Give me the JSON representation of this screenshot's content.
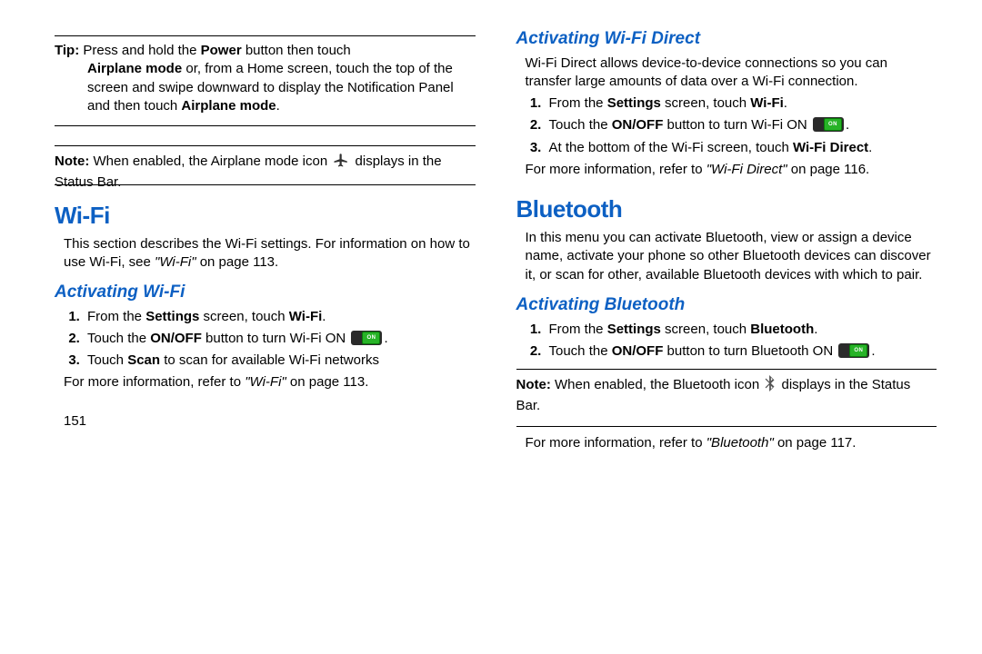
{
  "left": {
    "tip_label": "Tip:",
    "tip_text1": " Press and hold the ",
    "tip_b1": "Power",
    "tip_text2": " button then touch ",
    "tip_line2a": "Airplane mode",
    "tip_line2b": " or, from a Home screen, touch the top of the screen and swipe downward to display the Notification Panel and then touch ",
    "tip_b2": "Airplane mode",
    "tip_end": ".",
    "note_label": "Note:",
    "note_text1": " When enabled, the Airplane mode icon ",
    "note_text2": " displays in the Status Bar.",
    "wifi_h": "Wi-Fi",
    "wifi_p1": "This section describes the Wi-Fi settings. For information on how to use Wi-Fi, see ",
    "wifi_p1_ref": "\"Wi-Fi\"",
    "wifi_p1_end": " on page 113.",
    "act_wifi_h": "Activating Wi-Fi",
    "s1a": "From the ",
    "s1b": "Settings",
    "s1c": " screen, touch ",
    "s1d": "Wi-Fi",
    "s1e": ".",
    "s2a": "Touch the ",
    "s2b": "ON/OFF",
    "s2c": " button to turn Wi-Fi ON ",
    "s2d": ".",
    "s3a": "Touch ",
    "s3b": "Scan",
    "s3c": " to scan for available Wi-Fi networks",
    "more1a": "For more information, refer to ",
    "more1b": "\"Wi-Fi\"",
    "more1c": " on page 113.",
    "pagenum": "151"
  },
  "right": {
    "wfd_h": "Activating Wi-Fi Direct",
    "wfd_p": "Wi-Fi Direct allows device-to-device connections so you can transfer large amounts of data over a Wi-Fi connection.",
    "d1a": "From the ",
    "d1b": "Settings",
    "d1c": " screen, touch ",
    "d1d": "Wi-Fi",
    "d1e": ".",
    "d2a": "Touch the ",
    "d2b": "ON/OFF",
    "d2c": " button to turn Wi-Fi ON ",
    "d2d": ".",
    "d3a": "At the bottom of the Wi-Fi screen, touch ",
    "d3b": "Wi-Fi Direct",
    "d3c": ".",
    "more2a": "For more information, refer to ",
    "more2b": "\"Wi-Fi Direct\"",
    "more2c": " on page 116.",
    "bt_h": "Bluetooth",
    "bt_p": "In this menu you can activate Bluetooth, view or assign a device name, activate your phone so other Bluetooth devices can discover it, or scan for other, available Bluetooth devices with which to pair.",
    "act_bt_h": "Activating Bluetooth",
    "b1a": "From the ",
    "b1b": "Settings",
    "b1c": " screen, touch ",
    "b1d": "Bluetooth",
    "b1e": ".",
    "b2a": "Touch the ",
    "b2b": "ON/OFF",
    "b2c": " button to turn Bluetooth ON ",
    "b2d": ".",
    "note2_label": "Note:",
    "note2_text1": " When enabled, the Bluetooth icon ",
    "note2_text2": " displays in the Status Bar.",
    "more3a": "For more information, refer to ",
    "more3b": "\"Bluetooth\"",
    "more3c": " on page 117."
  }
}
